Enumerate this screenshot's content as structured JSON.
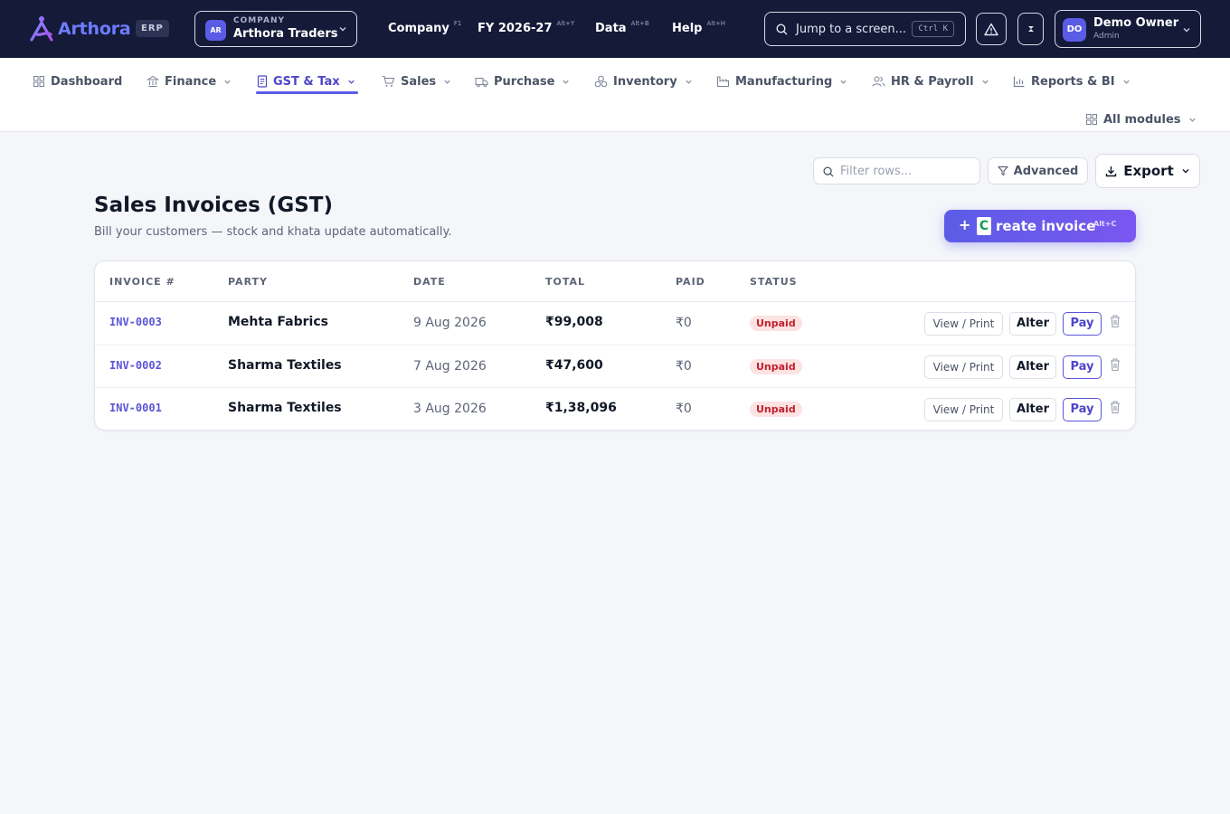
{
  "app": {
    "brand": "Arthora",
    "badge": "ERP",
    "brand_color": "#6d7cff",
    "accent_color": "#5b5ce6"
  },
  "company": {
    "caption": "COMPANY",
    "avatar": "AR",
    "name": "Arthora Traders"
  },
  "top_menu": [
    {
      "label": "Company",
      "shortcut": "F1"
    },
    {
      "label": "FY 2026-27",
      "shortcut": "Alt+Y"
    },
    {
      "label": "Data",
      "shortcut": "Alt+B"
    },
    {
      "label": "Help",
      "shortcut": "Alt+H"
    }
  ],
  "search": {
    "placeholder": "Jump to a screen...",
    "shortcut": "Ctrl K"
  },
  "icons": {
    "alert": "warning-triangle-icon",
    "theme": "contrast-icon"
  },
  "user": {
    "avatar": "DO",
    "name": "Demo Owner",
    "role": "Admin"
  },
  "modules": [
    {
      "label": "Dashboard",
      "icon": "grid-icon",
      "has_menu": false
    },
    {
      "label": "Finance",
      "icon": "bank-icon",
      "has_menu": true
    },
    {
      "label": "GST & Tax",
      "icon": "document-icon",
      "has_menu": true,
      "active": true
    },
    {
      "label": "Sales",
      "icon": "cart-icon",
      "has_menu": true
    },
    {
      "label": "Purchase",
      "icon": "truck-icon",
      "has_menu": true
    },
    {
      "label": "Inventory",
      "icon": "boxes-icon",
      "has_menu": true
    },
    {
      "label": "Manufacturing",
      "icon": "factory-icon",
      "has_menu": true
    },
    {
      "label": "HR & Payroll",
      "icon": "users-icon",
      "has_menu": true
    },
    {
      "label": "Reports & BI",
      "icon": "bar-chart-icon",
      "has_menu": true
    },
    {
      "label": "All modules",
      "icon": "grid-icon",
      "has_menu": true
    }
  ],
  "toolbar": {
    "filter_placeholder": "Filter rows...",
    "advanced_label": "Advanced",
    "export_label": "Export"
  },
  "page": {
    "title": "Sales Invoices (GST)",
    "subtitle": "Bill your customers — stock and khata update automatically.",
    "create_button": {
      "prefix": "+",
      "key_letter": "C",
      "label": "reate invoice",
      "shortcut": "Alt+C"
    }
  },
  "table": {
    "columns": [
      "INVOICE #",
      "PARTY",
      "DATE",
      "TOTAL",
      "PAID",
      "STATUS"
    ],
    "actions": {
      "view": "View / Print",
      "alter": "Alter",
      "pay": "Pay"
    },
    "rows": [
      {
        "invoice": "INV-0003",
        "party": "Mehta Fabrics",
        "date": "9 Aug 2026",
        "total": "₹99,008",
        "paid": "₹0",
        "status": "Unpaid"
      },
      {
        "invoice": "INV-0002",
        "party": "Sharma Textiles",
        "date": "7 Aug 2026",
        "total": "₹47,600",
        "paid": "₹0",
        "status": "Unpaid"
      },
      {
        "invoice": "INV-0001",
        "party": "Sharma Textiles",
        "date": "3 Aug 2026",
        "total": "₹1,38,096",
        "paid": "₹0",
        "status": "Unpaid"
      }
    ]
  }
}
